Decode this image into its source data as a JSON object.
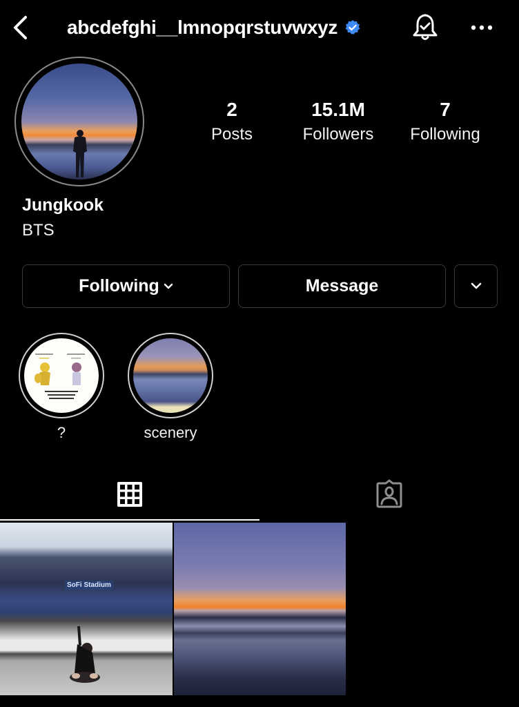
{
  "header": {
    "username": "abcdefghi__lmnopqrstuvwxyz",
    "verified": true,
    "back_icon": "chevron-left-icon",
    "verified_icon": "verified-badge-icon",
    "notification_icon": "bell-check-icon",
    "more_icon": "more-horizontal-icon"
  },
  "profile": {
    "full_name": "Jungkook",
    "bio": "BTS",
    "stats": [
      {
        "value": "2",
        "label": "Posts"
      },
      {
        "value": "15.1M",
        "label": "Followers"
      },
      {
        "value": "7",
        "label": "Following"
      }
    ]
  },
  "actions": {
    "following_label": "Following",
    "message_label": "Message",
    "suggest_icon": "chevron-down-icon"
  },
  "highlights": [
    {
      "label": "?"
    },
    {
      "label": "scenery"
    }
  ],
  "tabs": [
    {
      "name": "posts",
      "icon": "grid-icon",
      "active": true
    },
    {
      "name": "tagged",
      "icon": "tagged-person-icon",
      "active": false
    }
  ],
  "posts": [
    {
      "description": "Person sitting cross-legged in empty stadium",
      "overlay_text": "SoFi Stadium"
    },
    {
      "description": "Sunset over ocean shoreline"
    }
  ],
  "colors": {
    "background": "#000000",
    "text": "#ffffff",
    "verified": "#3d8af7",
    "button_border": "#3a3a3a"
  }
}
